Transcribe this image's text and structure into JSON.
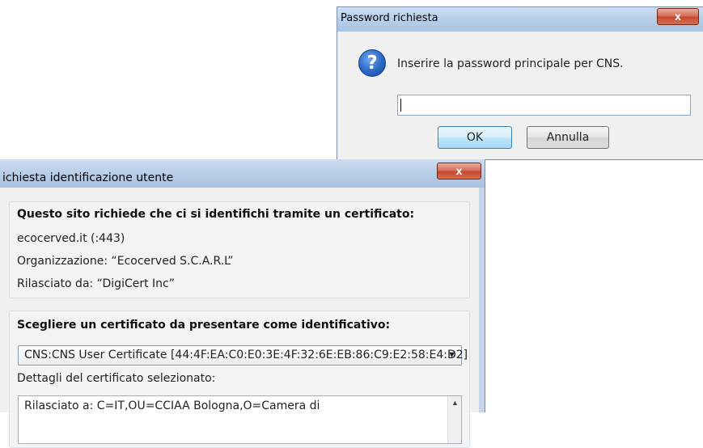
{
  "password_dialog": {
    "title": "Password richiesta",
    "close_label": "x",
    "icon": "question-icon",
    "message": "Inserire la password principale per CNS.",
    "password_value": "",
    "ok_label": "OK",
    "cancel_label": "Annulla"
  },
  "id_dialog": {
    "title": "ichiesta identificazione utente",
    "close_label": "x",
    "site_heading": "Questo sito richiede che ci si identifichi tramite un certificato:",
    "site": "ecocerved.it (:443)",
    "organization": "Organizzazione: “Ecocerved S.C.A.R.L”",
    "issuer": "Rilasciato da: “DigiCert Inc”",
    "cert_heading": "Scegliere un certificato da presentare come identificativo:",
    "selected_certificate": "CNS:CNS User Certificate [44:4F:EA:C0:E0:3E:4F:32:6E:EB:86:C9:E2:58:E4:D2]",
    "details_label": "Dettagli del certificato selezionato:",
    "details_text": "Rilasciato a: C=IT,OU=CCIAA Bologna,O=Camera di"
  },
  "colors": {
    "titlebar": "#b9d0ea",
    "close_button": "#c6482d",
    "dialog_bg": "#f0f0f0"
  }
}
